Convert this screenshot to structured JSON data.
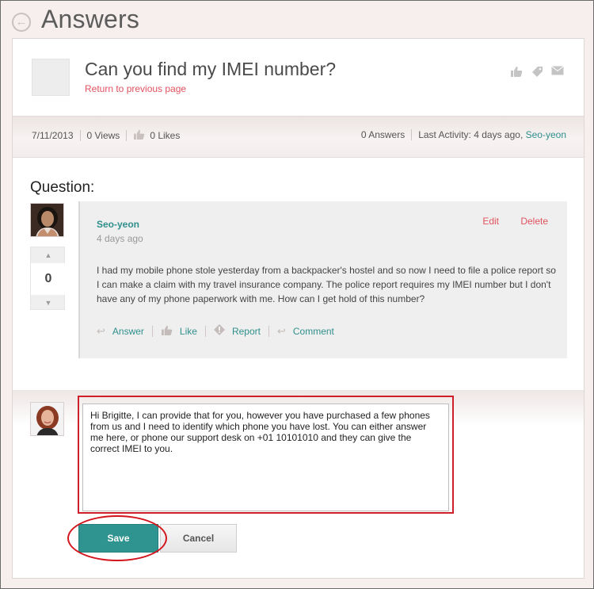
{
  "header": {
    "back_icon": "arrow-left-circle-icon",
    "title": "Answers"
  },
  "question": {
    "title": "Can you find my IMEI number?",
    "return_link": "Return to previous page",
    "top_icons": [
      "thumbs-up-icon",
      "tag-icon",
      "envelope-icon"
    ]
  },
  "meta": {
    "date": "7/11/2013",
    "views": "0 Views",
    "likes": "0 Likes",
    "answers": "0 Answers",
    "last_activity_label": "Last Activity: 4 days ago,",
    "last_activity_user": "Seo-yeon"
  },
  "section_label": "Question:",
  "post": {
    "author": "Seo-yeon",
    "time": "4 days ago",
    "edit": "Edit",
    "delete": "Delete",
    "vote_count": "0",
    "body": "I had my mobile phone stole yesterday from a backpacker's hostel and so now I need to file a police report so I can make a claim with my travel insurance company. The police report requires my IMEI number but I don't have any of my phone paperwork with me. How can I get hold of this number?",
    "actions": {
      "answer": "Answer",
      "like": "Like",
      "report": "Report",
      "comment": "Comment"
    }
  },
  "reply": {
    "text": "Hi Brigitte, I can provide that for you, however you have purchased a few phones from us and I need to identify which phone you have lost. You can either answer me here, or phone our support desk on +01 10101010 and they can give the correct IMEI to you.",
    "save": "Save",
    "cancel": "Cancel"
  },
  "colors": {
    "accent_teal": "#2f938f",
    "link_red": "#e0535f",
    "highlight_red": "#d3141d"
  }
}
